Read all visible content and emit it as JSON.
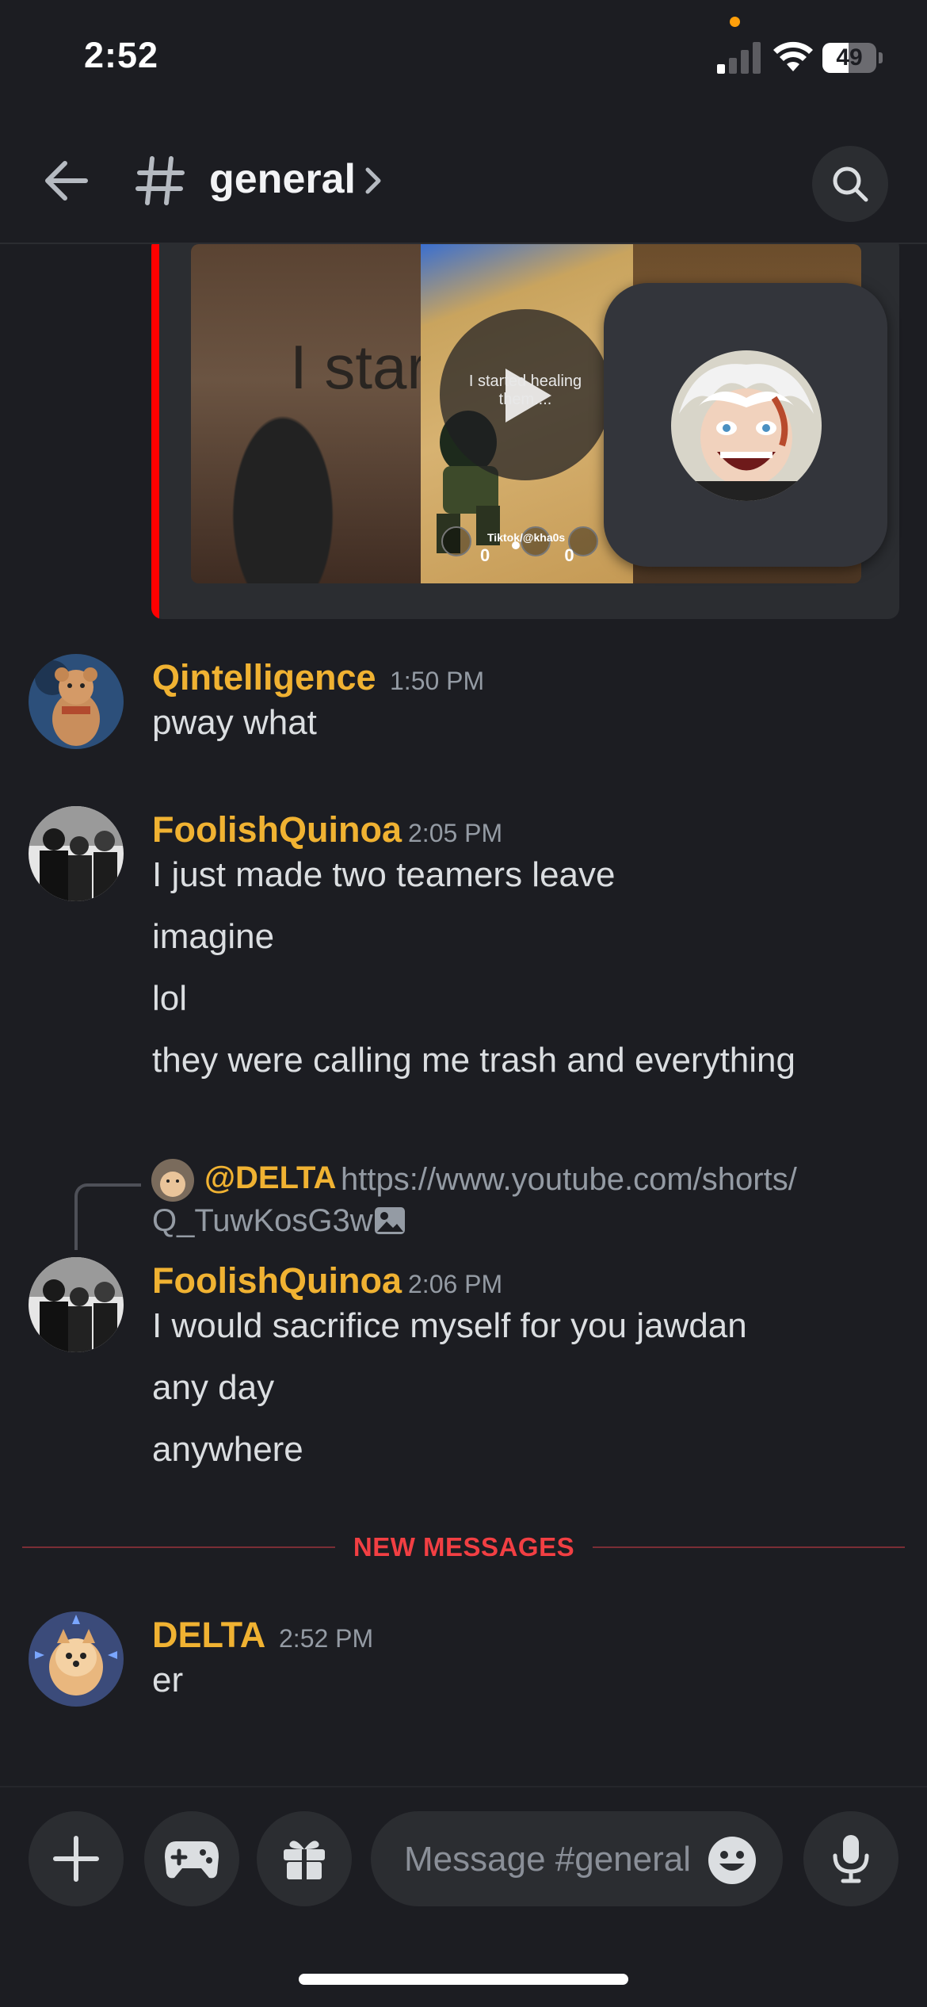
{
  "status_bar": {
    "time": "2:52",
    "battery_percent": "49",
    "battery_level": 0.49,
    "signal_bars_active": 1
  },
  "header": {
    "channel_hash": "#",
    "channel_name": "general",
    "icons": {
      "back": "arrow-left-icon",
      "search": "search-icon",
      "more": "chevron-right-icon"
    }
  },
  "embed": {
    "accent_color": "#ff0000",
    "thumbnail_text_left": "I star",
    "thumbnail_caption": "I started healing them....",
    "thumbnail_watermark": "Tiktok/@kha0s",
    "thumbnail_counters": "0 0 0"
  },
  "messages": [
    {
      "author": "Qintelligence",
      "time": "1:50 PM",
      "lines": [
        "pway what"
      ]
    },
    {
      "author": "FoolishQuinoa",
      "time": "2:05 PM",
      "lines": [
        "I just made two teamers leave",
        "imagine",
        "lol",
        "they were calling me trash and everything"
      ]
    },
    {
      "reply": {
        "mention": "@DELTA",
        "text_line1": "https://www.youtube.com/shorts/",
        "text_line2": "Q_TuwKosG3w"
      },
      "author": "FoolishQuinoa",
      "time": "2:06 PM",
      "lines": [
        "I would sacrifice myself for you jawdan",
        "any day",
        "anywhere"
      ]
    },
    {
      "author": "DELTA",
      "time": "2:52 PM",
      "lines": [
        "er"
      ]
    }
  ],
  "divider": {
    "label": "NEW MESSAGES"
  },
  "composer": {
    "placeholder": "Message #general",
    "icons": [
      "plus-icon",
      "gamepad-icon",
      "gift-icon",
      "emoji-icon",
      "microphone-icon"
    ]
  },
  "colors": {
    "background": "#1c1d22",
    "author_name": "#f0b232",
    "timestamp": "#949ba4",
    "new_messages": "#f23f43"
  }
}
